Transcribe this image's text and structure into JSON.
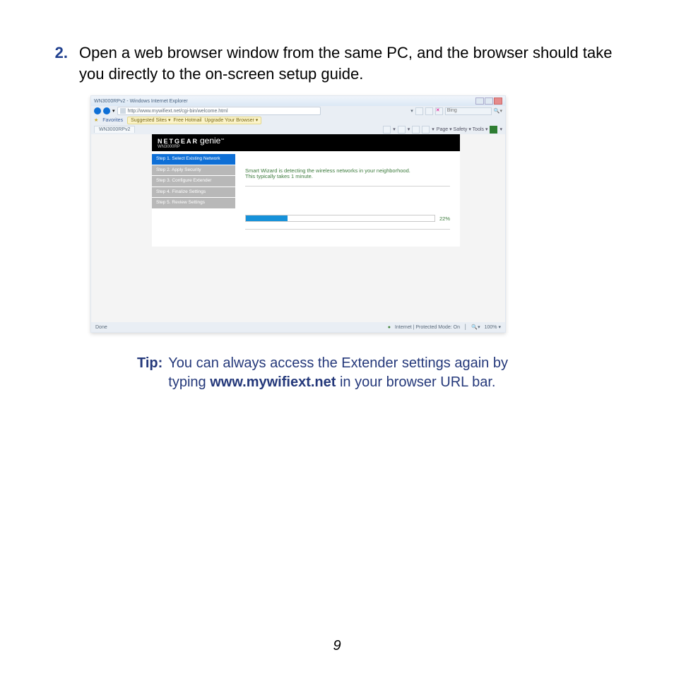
{
  "step": {
    "number": "2.",
    "text": "Open a web browser window from the same PC, and the browser should take you directly to the on-screen setup guide."
  },
  "screenshot": {
    "window_title": "WN3000RPv2 - Windows Internet Explorer",
    "url": "http://www.mywifiext.net/cgi-bin/welcome.html",
    "search_placeholder": "Bing",
    "favorites_label": "Favorites",
    "fav_links": {
      "a": "Suggested Sites ▾",
      "b": "Free Hotmail",
      "c": "Upgrade Your Browser ▾"
    },
    "tab_label": "WN3000RPv2",
    "toolbar": "Page ▾   Safety ▾   Tools ▾",
    "brand": {
      "name": "NETGEAR",
      "product": "genie",
      "model": "WN3000RP"
    },
    "wizard_steps": [
      "Step 1. Select Existing Network",
      "Step 2. Apply Security",
      "Step 3. Configure Extender",
      "Step 4. Finalize Settings",
      "Step 5. Review Settings"
    ],
    "wizard_msg_line1": "Smart Wizard is detecting the wireless networks in your neighborhood.",
    "wizard_msg_line2": "This typically takes 1 minute.",
    "progress": {
      "percent_label": "22%",
      "percent_css": "22%"
    },
    "status_left": "Done",
    "status_mode": "Internet | Protected Mode: On",
    "status_zoom": "100%  ▾"
  },
  "tip": {
    "label": "Tip:",
    "before": "You can always access the Extender settings again by typing ",
    "url": "www.mywifiext.net",
    "after": " in your browser URL bar."
  },
  "page_number": "9"
}
